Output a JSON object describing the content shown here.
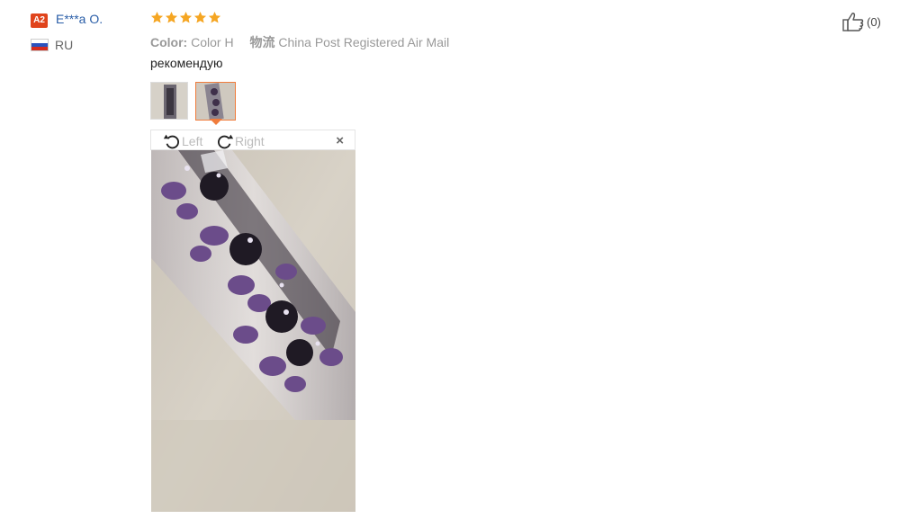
{
  "reviewer": {
    "badge": "A2",
    "name": "E***a O.",
    "country": "RU",
    "flag_colors": [
      "#ffffff",
      "#2a52be",
      "#d52b1e"
    ]
  },
  "review": {
    "rating": 5,
    "star_color": "#f5a623",
    "color_label": "Color:",
    "color_value": "Color H",
    "shipping_label": "物流",
    "shipping_value": "China Post Registered Air Mail",
    "text": "рекомендую"
  },
  "viewer": {
    "rotate_left_label": "Left",
    "rotate_right_label": "Right",
    "close_label": "×"
  },
  "helpful": {
    "count": "(0)"
  },
  "accent_color": "#f07c3c"
}
